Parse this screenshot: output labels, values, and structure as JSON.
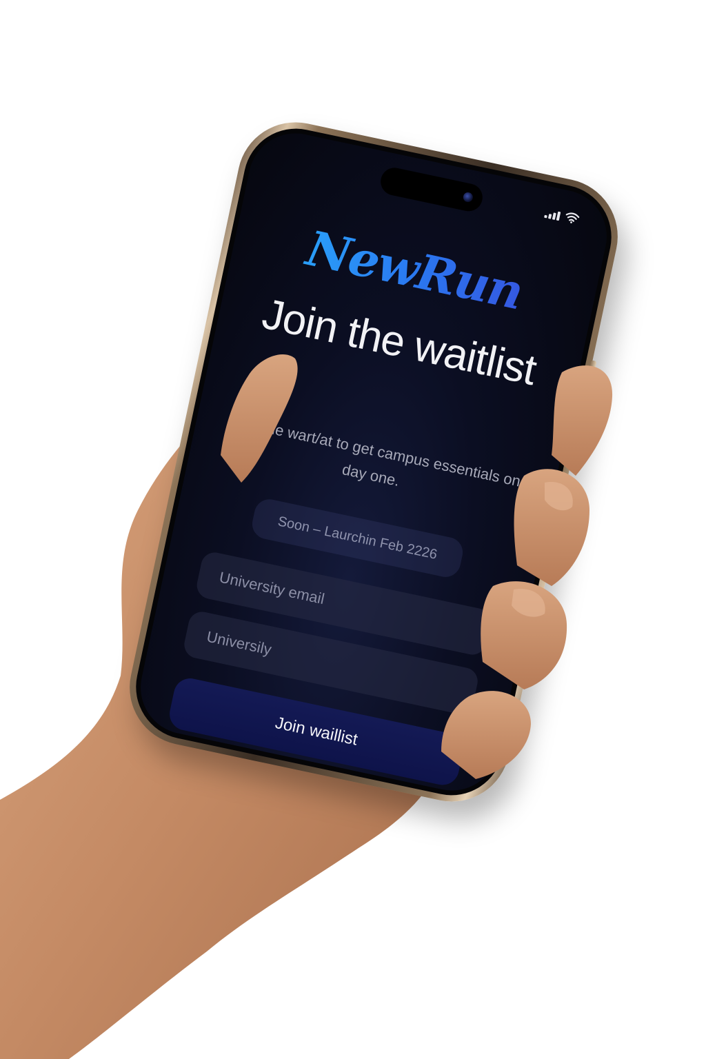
{
  "status_bar": {
    "signal_icon": "cellular-signal-icon",
    "wifi_icon": "wifi-icon"
  },
  "app": {
    "logo_text": "NewRun",
    "title": "Join the waitlist",
    "subtitle": "Join the wart/at to get campus essentials on day one.",
    "launch_badge": "Soon – Laurchin Feb 2226"
  },
  "form": {
    "email_placeholder": "University email",
    "university_placeholder": "Universily",
    "submit_label": "Join waillist"
  },
  "colors": {
    "screen_bg": "#06070f",
    "logo_gradient_start": "#29b8ff",
    "logo_gradient_end": "#3c44d8",
    "button_bg": "#141a55",
    "phone_frame": "#c8b090"
  }
}
